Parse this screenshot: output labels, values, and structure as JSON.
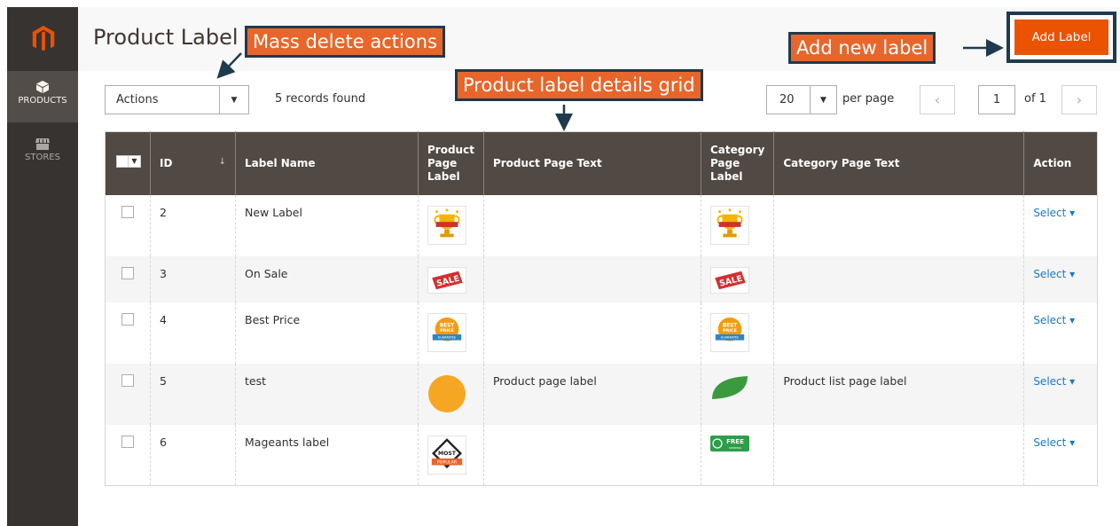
{
  "app": {
    "title": "Product Label"
  },
  "sidebar": {
    "items": [
      {
        "label": "PRODUCTS",
        "icon": "box-icon",
        "active": true
      },
      {
        "label": "STORES",
        "icon": "store-icon",
        "active": false
      }
    ]
  },
  "header": {
    "add_label": "Add Label"
  },
  "callouts": {
    "mass_delete": "Mass delete actions",
    "grid": "Product label details grid",
    "add_new": "Add new label"
  },
  "toolbar": {
    "actions_label": "Actions",
    "records_found": "5 records found",
    "per_page_value": "20",
    "per_page_text": "per page",
    "prev": "‹",
    "next": "›",
    "current_page": "1",
    "of_pages": "of 1"
  },
  "grid": {
    "columns": [
      "ID",
      "Label Name",
      "Product Page Label",
      "Product Page Text",
      "Category Page Label",
      "Category Page Text",
      "Action"
    ],
    "rows": [
      {
        "id": "2",
        "name": "New Label",
        "product_label_icon": "trophy-icon",
        "product_text": "",
        "category_label_icon": "trophy-icon",
        "category_text": "",
        "action": "Select ▾"
      },
      {
        "id": "3",
        "name": "On Sale",
        "product_label_icon": "sale-tag-icon",
        "product_text": "",
        "category_label_icon": "sale-tag-icon",
        "category_text": "",
        "action": "Select ▾"
      },
      {
        "id": "4",
        "name": "Best Price",
        "product_label_icon": "best-price-badge-icon",
        "product_text": "",
        "category_label_icon": "best-price-badge-icon",
        "category_text": "",
        "action": "Select ▾"
      },
      {
        "id": "5",
        "name": "test",
        "product_label_icon": "orange-circle-icon",
        "product_text": "Product page label",
        "category_label_icon": "green-leaf-icon",
        "category_text": "Product list page label",
        "action": "Select ▾"
      },
      {
        "id": "6",
        "name": "Mageants label",
        "product_label_icon": "most-popular-badge-icon",
        "product_text": "",
        "category_label_icon": "free-shipping-icon",
        "category_text": "",
        "action": "Select ▾"
      }
    ],
    "badge_text": {
      "best": "BEST",
      "price": "PRICE",
      "guarantee": "GUARANTEE",
      "sale": "SALE",
      "most": "MOST",
      "popular": "POPULAR",
      "free": "FREE",
      "shipping": "SHIPPING"
    }
  },
  "colors": {
    "accent": "#eb5202",
    "callout": "#e8662b",
    "callout_border": "#1f3a4d",
    "header_bg": "#514943",
    "sidebar_bg": "#373330",
    "link": "#1979c3"
  }
}
